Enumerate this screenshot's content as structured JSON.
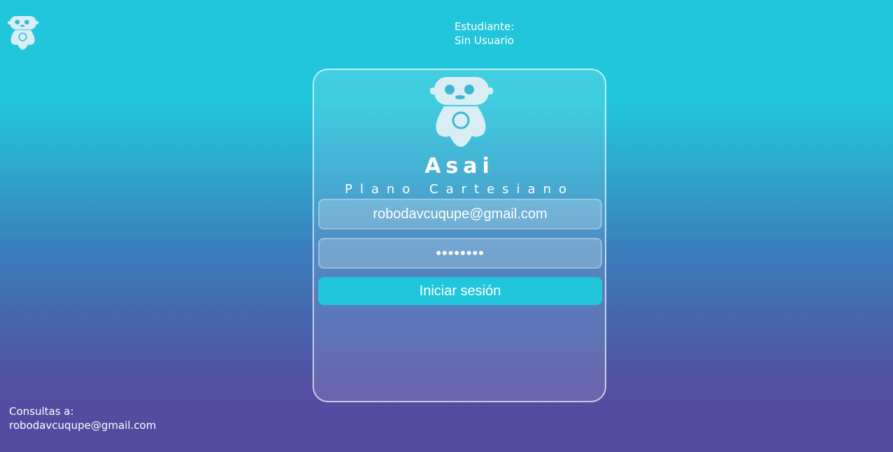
{
  "header": {
    "logo_icon": "robot-icon",
    "student_label": "Estudiante:",
    "student_name": "Sin Usuario"
  },
  "login": {
    "logo_icon": "robot-icon",
    "title": "Asai",
    "subtitle": "Plano Cartesiano",
    "email_value": "robodavcuqupe@gmail.com",
    "password_value": "••••••••",
    "submit_label": "Iniciar sesión"
  },
  "footer": {
    "contact_label": "Consultas a:",
    "contact_email": "robodavcuqupe@gmail.com"
  },
  "colors": {
    "accent": "#22c6dc",
    "background_top": "#22c6dc",
    "background_bottom": "#524ba0",
    "icon_fill": "#d8eef4"
  }
}
